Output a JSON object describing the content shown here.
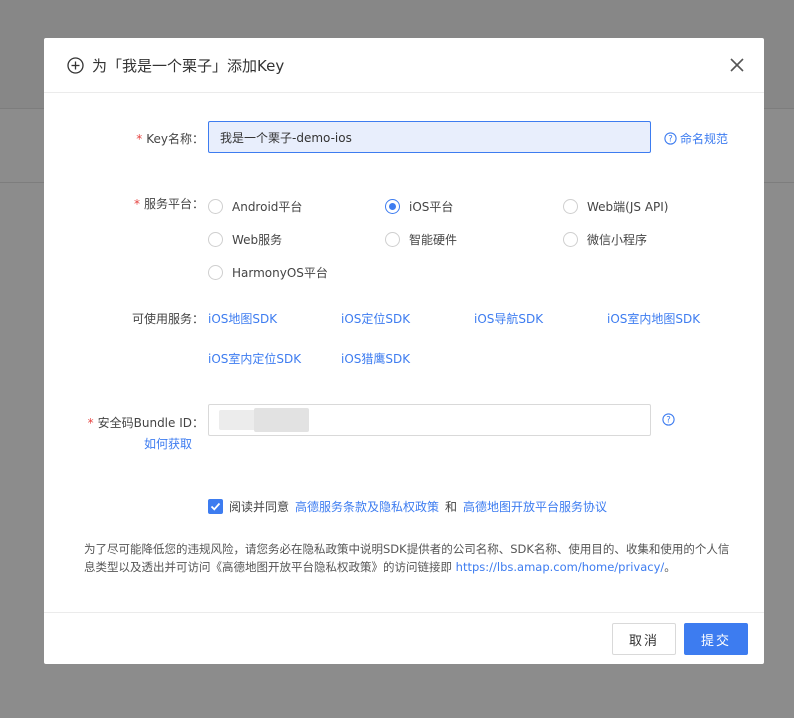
{
  "dialog": {
    "title": "为「我是一个栗子」添加Key"
  },
  "form": {
    "key_name": {
      "required_mark": "*",
      "label": "Key名称：",
      "value": "我是一个栗子-demo-ios",
      "help": "命名规范"
    },
    "platform": {
      "required_mark": "*",
      "label": "服务平台：",
      "options": [
        {
          "label": "Android平台",
          "checked": false
        },
        {
          "label": "iOS平台",
          "checked": true
        },
        {
          "label": "Web端(JS API)",
          "checked": false
        },
        {
          "label": "Web服务",
          "checked": false
        },
        {
          "label": "智能硬件",
          "checked": false
        },
        {
          "label": "微信小程序",
          "checked": false
        },
        {
          "label": "HarmonyOS平台",
          "checked": false
        }
      ]
    },
    "services": {
      "label": "可使用服务：",
      "items": [
        "iOS地图SDK",
        "iOS定位SDK",
        "iOS导航SDK",
        "iOS室内地图SDK",
        "iOS室内定位SDK",
        "iOS猎鹰SDK"
      ]
    },
    "bundle_id": {
      "required_mark": "*",
      "label": "安全码Bundle ID：",
      "how_to": "如何获取",
      "value": ""
    }
  },
  "agreement": {
    "checked": true,
    "prefix": "阅读并同意",
    "link1": "高德服务条款及隐私权政策",
    "and": "和",
    "link2": "高德地图开放平台服务协议"
  },
  "notice": {
    "text": "为了尽可能降低您的违规风险，请您务必在隐私政策中说明SDK提供者的公司名称、SDK名称、使用目的、收集和使用的个人信息类型以及透出并可访问《高德地图开放平台隐私权政策》的访问链接即 ",
    "link": "https://lbs.amap.com/home/privacy/",
    "suffix": "。"
  },
  "buttons": {
    "cancel": "取消",
    "submit": "提交"
  },
  "colors": {
    "accent": "#3d7cf0",
    "required": "#e64340"
  }
}
